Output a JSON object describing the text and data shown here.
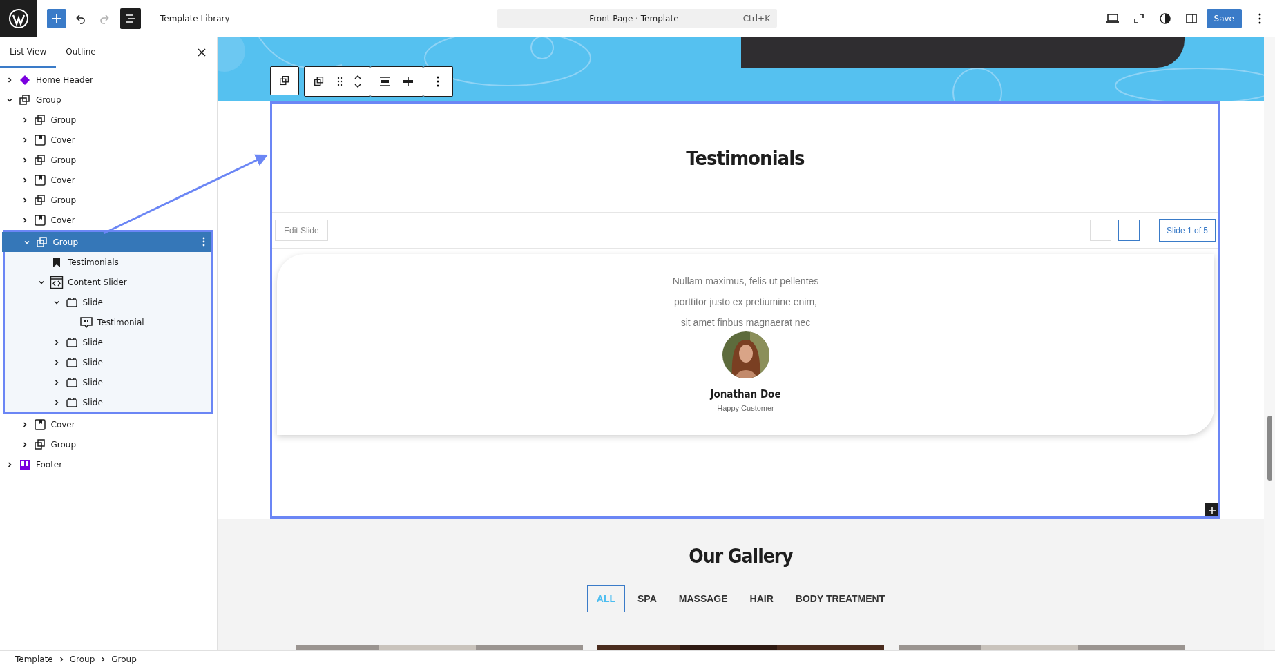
{
  "top_bar": {
    "title": "Template Library",
    "command": {
      "label": "Front Page · Template",
      "shortcut": "Ctrl+K"
    },
    "redo_disabled": true,
    "list_view_active": true,
    "save": "Save"
  },
  "sidebar": {
    "tabs": [
      {
        "label": "List View",
        "selected": true
      },
      {
        "label": "Outline",
        "selected": false
      }
    ],
    "tree": [
      {
        "label": "Home Header",
        "kind": "header",
        "expanded": false,
        "selected": false
      },
      {
        "label": "Group",
        "kind": "group",
        "expanded": true,
        "selected": false,
        "children": [
          {
            "label": "Group",
            "kind": "group",
            "expanded": false,
            "selected": false
          },
          {
            "label": "Cover",
            "kind": "cover",
            "expanded": false,
            "selected": false
          },
          {
            "label": "Group",
            "kind": "group",
            "expanded": false,
            "selected": false
          },
          {
            "label": "Cover",
            "kind": "cover",
            "expanded": false,
            "selected": false
          },
          {
            "label": "Group",
            "kind": "group",
            "expanded": false,
            "selected": false
          },
          {
            "label": "Cover",
            "kind": "cover",
            "expanded": false,
            "selected": false
          },
          {
            "label": "Group",
            "kind": "group",
            "expanded": true,
            "selected": true,
            "children": [
              {
                "label": "Testimonials",
                "kind": "heading",
                "selected": false
              },
              {
                "label": "Content Slider",
                "kind": "slider",
                "expanded": true,
                "selected": false,
                "children": [
                  {
                    "label": "Slide",
                    "kind": "slide",
                    "expanded": true,
                    "selected": false,
                    "children": [
                      {
                        "label": "Testimonial",
                        "kind": "testimonial",
                        "selected": false
                      }
                    ]
                  },
                  {
                    "label": "Slide",
                    "kind": "slide",
                    "expanded": false,
                    "selected": false
                  },
                  {
                    "label": "Slide",
                    "kind": "slide",
                    "expanded": false,
                    "selected": false
                  },
                  {
                    "label": "Slide",
                    "kind": "slide",
                    "expanded": false,
                    "selected": false
                  },
                  {
                    "label": "Slide",
                    "kind": "slide",
                    "expanded": false,
                    "selected": false
                  }
                ]
              }
            ]
          },
          {
            "label": "Cover",
            "kind": "cover",
            "expanded": false,
            "selected": false
          },
          {
            "label": "Group",
            "kind": "group",
            "expanded": false,
            "selected": false
          }
        ]
      },
      {
        "label": "Footer",
        "kind": "footer",
        "expanded": false,
        "selected": false
      }
    ],
    "breadcrumbs": [
      "Template",
      "Group",
      "Group"
    ]
  },
  "canvas": {
    "heading": "Testimonials",
    "slider": {
      "edit": "Edit Slide",
      "counter": "Slide 1 of 5"
    },
    "testimonial": {
      "quote_lines": [
        "Nullam maximus, felis ut pellentes",
        "porttitor justo ex pretiumine enim,",
        "sit amet finbus magnaerat nec"
      ],
      "name": "Jonathan Doe",
      "role": "Happy Customer"
    },
    "gallery": {
      "title": "Our Gallery",
      "filters": [
        {
          "label": "ALL",
          "selected": true
        },
        {
          "label": "SPA",
          "selected": false
        },
        {
          "label": "MASSAGE",
          "selected": false
        },
        {
          "label": "HAIR",
          "selected": false
        },
        {
          "label": "BODY TREATMENT",
          "selected": false
        }
      ]
    }
  }
}
